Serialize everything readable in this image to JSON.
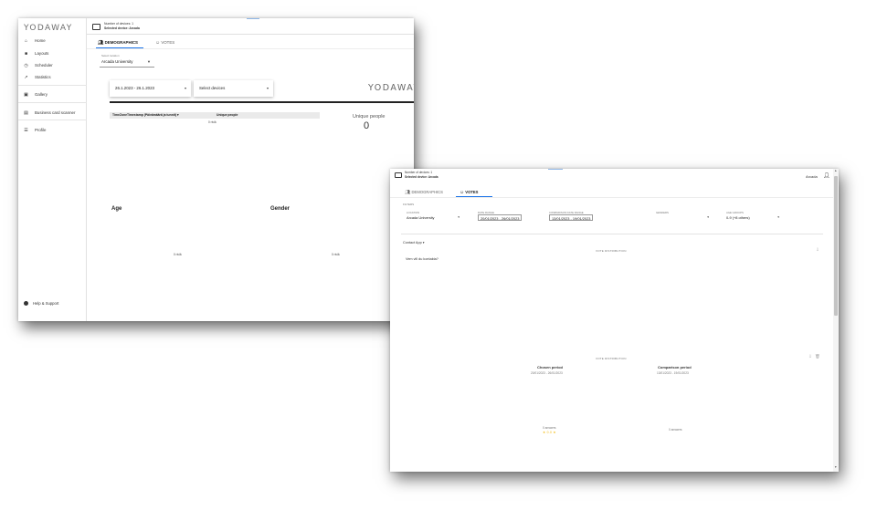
{
  "win1": {
    "logo": "YODAWAY",
    "device": {
      "count": "Number of devices: 1",
      "selected": "Selected device: Arcada"
    },
    "nav": [
      {
        "icon": "home-icon",
        "glyph": "⌂",
        "label": "Home"
      },
      {
        "icon": "layouts-icon",
        "glyph": "■",
        "label": "Layouts"
      },
      {
        "icon": "scheduler-icon",
        "glyph": "◷",
        "label": "Scheduler"
      },
      {
        "icon": "statistics-icon",
        "glyph": "↗",
        "label": "Statistics"
      },
      {
        "icon": "gallery-icon",
        "glyph": "▣",
        "label": "Gallery"
      },
      {
        "icon": "business-card-icon",
        "glyph": "▤",
        "label": "Business card scanner"
      },
      {
        "icon": "profile-icon",
        "glyph": "☰",
        "label": "Profile"
      }
    ],
    "help": "Help & Support",
    "tabs": {
      "demographics": "DEMOGRAPHICS",
      "votes": "VOTES"
    },
    "location": {
      "label": "Select location",
      "value": "Arcada University"
    },
    "date_range": "26.1.2023 - 26.1.2023",
    "devices_placeholder": "Select devices",
    "big_logo": "YODAWAY",
    "table": {
      "col1": "TimeZoneTimestamp (Päivämäärä ja tunnit)",
      "col2": "Unique people",
      "empty": "0 riviä"
    },
    "unique_people": {
      "label": "Unique people",
      "value": "0"
    },
    "age": {
      "title": "Age",
      "empty": "0 riviä"
    },
    "gender": {
      "title": "Gender",
      "empty": "0 riviä"
    }
  },
  "win2": {
    "device": {
      "count": "Number of devices: 1",
      "selected": "Selected device: Arcada"
    },
    "user": "Arcada",
    "tabs": {
      "demographics": "DEMOGRAPHICS",
      "votes": "VOTES"
    },
    "filters_label": "FILTERS",
    "filters": {
      "location": {
        "label": "LOCATION",
        "value": "Arcada University"
      },
      "date_range": {
        "label": "DATE RANGE",
        "value": "20/01/2023 - 26/01/2023"
      },
      "comparison": {
        "label": "COMPARISON DATE RANGE",
        "value": "13/01/2023 - 19/01/2023"
      },
      "genders": {
        "label": "GENDERS",
        "value": ""
      },
      "age_groups": {
        "label": "AGE GROUPS",
        "value": "0-9 (+8 others)"
      }
    },
    "app_select": "Contact App",
    "vote_distribution_1": "VOTE DISTRIBUTION",
    "question": "Vem vill du kontakta?",
    "vote_distribution_2": "VOTE DISTRIBUTION",
    "chosen": {
      "title": "Chosen period",
      "dates": "20/01/2023 - 26/01/2023",
      "answers": "0 answers",
      "stars": "★ 0.0 ★"
    },
    "comparison": {
      "title": "Comparison period",
      "dates": "13/01/2023 - 19/01/2023",
      "answers": "0 answers"
    }
  }
}
